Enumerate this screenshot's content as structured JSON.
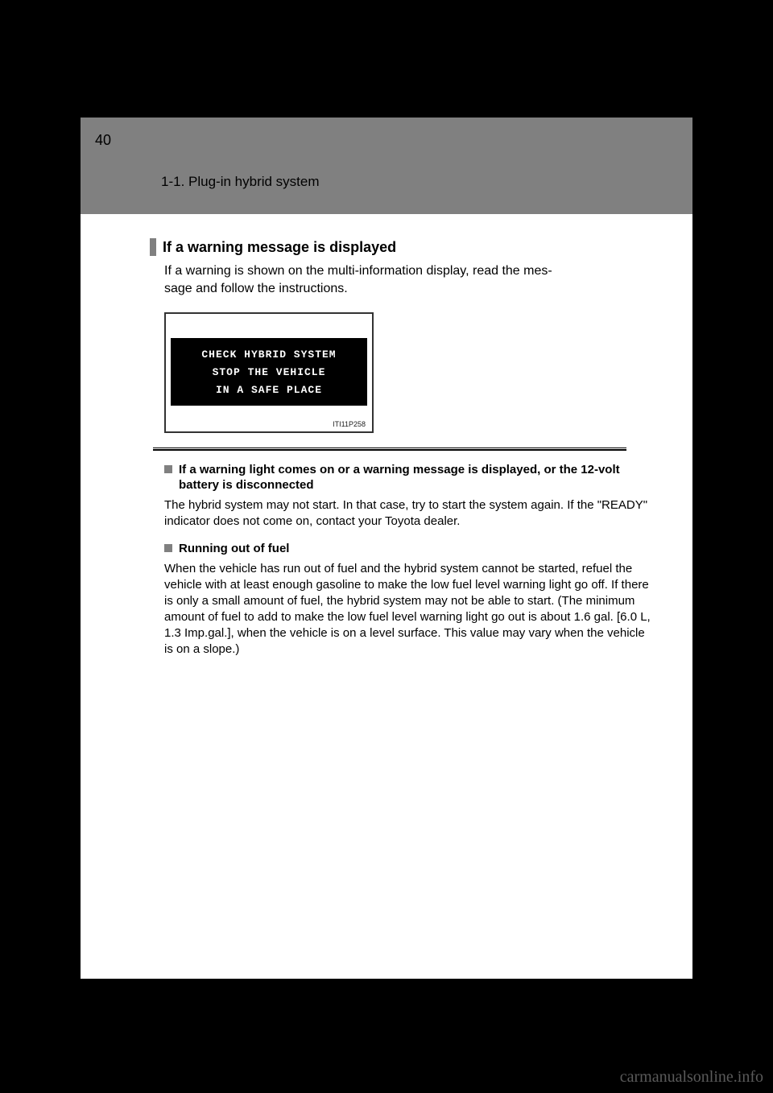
{
  "header": {
    "page_number": "40",
    "section": "1-1. Plug-in hybrid system"
  },
  "heading": "If a warning message is displayed",
  "intro": "If a warning is shown on the multi-information display, read the mes-\nsage and follow the instructions.",
  "figure": {
    "line1": "CHECK HYBRID SYSTEM",
    "line2": "STOP THE VEHICLE",
    "line3": "IN A SAFE PLACE",
    "code": "ITI11P258"
  },
  "subs": [
    {
      "title": "If a warning light comes on or a warning message is displayed, or the 12-volt battery is disconnected",
      "body": "The hybrid system may not start. In that case, try to start the system again. If the \"READY\" indicator does not come on, contact your Toyota dealer."
    },
    {
      "title": "Running out of fuel",
      "body": "When the vehicle has run out of fuel and the hybrid system cannot be started, refuel the vehicle with at least enough gasoline to make the low fuel level warning light go off. If there is only a small amount of fuel, the hybrid system may not be able to start. (The minimum amount of fuel to add to make the low fuel level warning light go out is about 1.6 gal. [6.0 L, 1.3 Imp.gal.], when the vehicle is on a level surface. This value may vary when the vehicle is on a slope.)"
    }
  ],
  "watermark": "carmanualsonline.info"
}
